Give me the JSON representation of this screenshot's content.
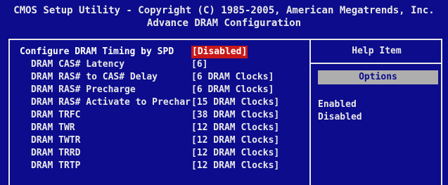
{
  "header": {
    "line1": "CMOS Setup Utility - Copyright (C) 1985-2005, American Megatrends, Inc.",
    "line2": "Advance DRAM Configuration"
  },
  "settings": [
    {
      "label": "Configure DRAM Timing by SPD",
      "value": "[Disabled]",
      "selected": true
    },
    {
      "label": "DRAM CAS# Latency",
      "value": "[6]"
    },
    {
      "label": "DRAM RAS# to CAS# Delay",
      "value": "[6 DRAM Clocks]"
    },
    {
      "label": "DRAM RAS# Precharge",
      "value": "[6 DRAM Clocks]"
    },
    {
      "label": "DRAM RAS# Activate to Prechar",
      "value": "[15 DRAM Clocks]"
    },
    {
      "label": "DRAM TRFC",
      "value": "[38 DRAM Clocks]"
    },
    {
      "label": "DRAM TWR",
      "value": "[12 DRAM Clocks]"
    },
    {
      "label": "DRAM TWTR",
      "value": "[12 DRAM Clocks]"
    },
    {
      "label": "DRAM TRRD",
      "value": "[12 DRAM Clocks]"
    },
    {
      "label": "DRAM TRTP",
      "value": "[12 DRAM Clocks]"
    }
  ],
  "help": {
    "title": "Help Item",
    "options_label": "Options",
    "options": [
      "Enabled",
      "Disabled"
    ]
  },
  "colors": {
    "background": "#0c0c8c",
    "text": "#e8e8e8",
    "selection": "#c81818",
    "options_box": "#aeaeae"
  }
}
